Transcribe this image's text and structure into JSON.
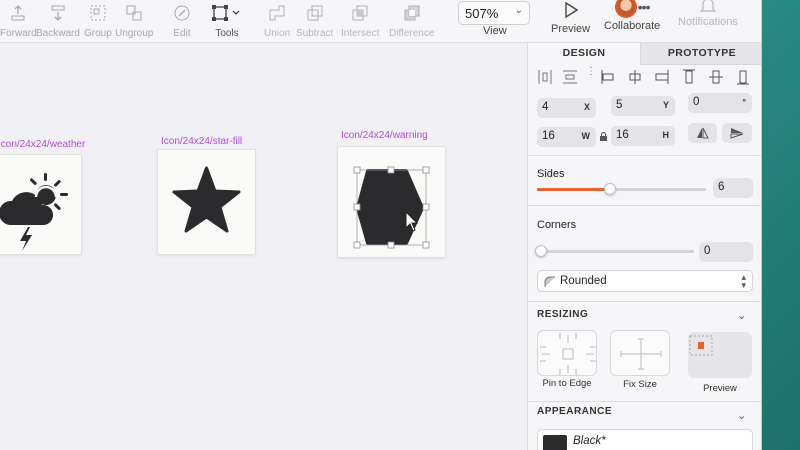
{
  "toolbar": {
    "forward": "Forward",
    "backward": "Backward",
    "group": "Group",
    "ungroup": "Ungroup",
    "edit": "Edit",
    "tools": "Tools",
    "union": "Union",
    "subtract": "Subtract",
    "intersect": "Intersect",
    "difference": "Difference",
    "zoom_value": "507%",
    "zoom_label": "View",
    "preview": "Preview",
    "collaborate": "Collaborate",
    "notifications": "Notifications"
  },
  "canvas": {
    "artboards": [
      {
        "label": "Icon/24x24/weather"
      },
      {
        "label": "Icon/24x24/star-fill"
      },
      {
        "label": "Icon/24x24/warning"
      }
    ]
  },
  "inspector": {
    "tabs": {
      "design": "DESIGN",
      "prototype": "PROTOTYPE"
    },
    "position": {
      "x": "4",
      "x_suffix": "X",
      "y": "5",
      "y_suffix": "Y",
      "rotation": "0",
      "rotation_suffix": "°"
    },
    "size": {
      "w": "16",
      "w_suffix": "W",
      "h": "16",
      "h_suffix": "H"
    },
    "sides": {
      "label": "Sides",
      "value": "6",
      "slider_fraction": 0.43
    },
    "corners": {
      "label": "Corners",
      "value": "0",
      "slider_fraction": 0.0
    },
    "corner_style": "Rounded",
    "resizing": {
      "title": "RESIZING",
      "pin_label": "Pin to Edge",
      "fix_label": "Fix Size",
      "preview_label": "Preview"
    },
    "appearance": {
      "title": "APPEARANCE",
      "style_name": "Black*"
    }
  },
  "colors": {
    "accent": "#e8622c",
    "artboard_label": "#b14ed6",
    "shape_fill": "#2b2b2d"
  }
}
